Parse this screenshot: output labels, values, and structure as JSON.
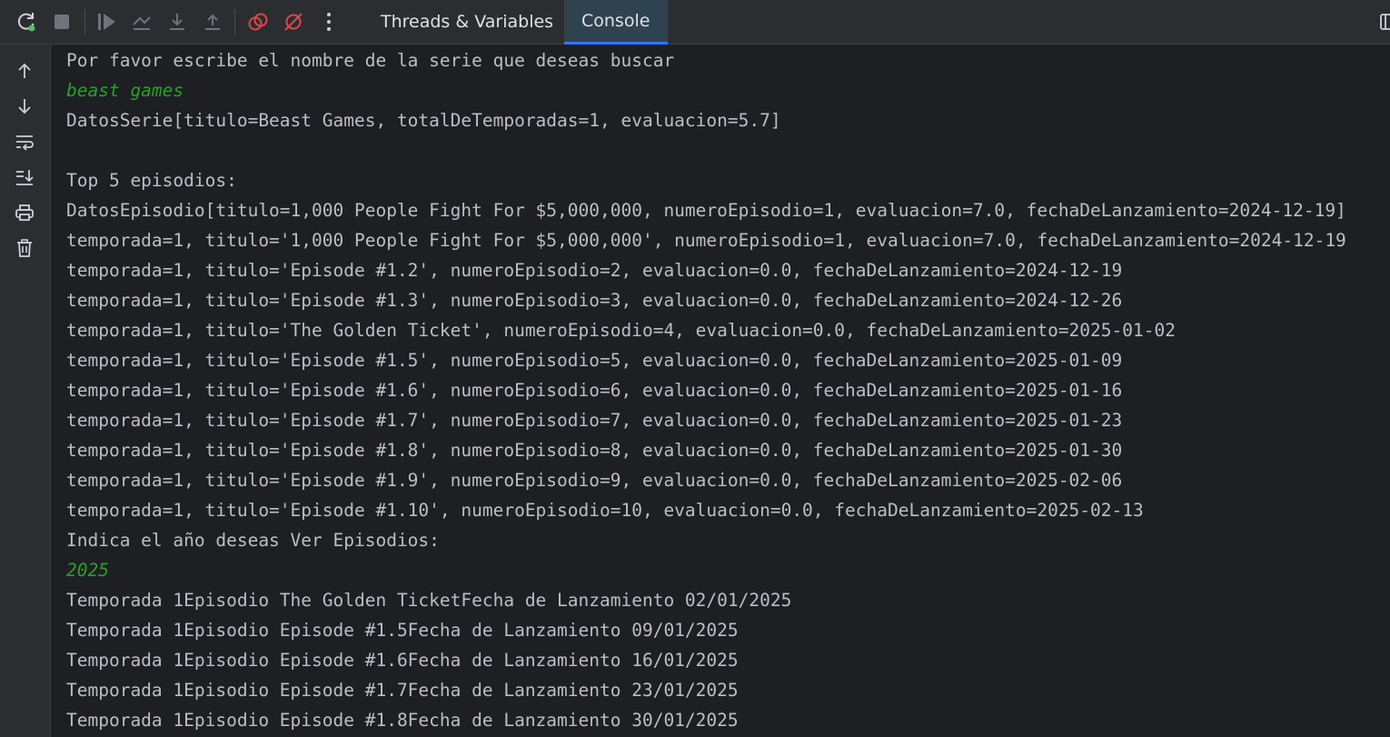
{
  "toolbar": {
    "buttons": [
      {
        "name": "rerun-debug-icon"
      },
      {
        "name": "stop-icon"
      },
      {
        "name": "resume-icon"
      },
      {
        "name": "step-over-icon"
      },
      {
        "name": "step-into-icon"
      },
      {
        "name": "step-out-icon"
      },
      {
        "name": "view-breakpoints-icon"
      },
      {
        "name": "mute-breakpoints-icon"
      },
      {
        "name": "more-options-icon"
      }
    ],
    "tabs": [
      {
        "label": "Threads & Variables",
        "active": false
      },
      {
        "label": "Console",
        "active": true
      }
    ]
  },
  "sidebar": {
    "icons": [
      "scroll-up-icon",
      "scroll-down-icon",
      "soft-wrap-icon",
      "scroll-to-end-icon",
      "print-icon",
      "clear-console-icon"
    ]
  },
  "console": {
    "lines": [
      {
        "text": "Por favor escribe el nombre de la serie que deseas buscar",
        "type": "output"
      },
      {
        "text": "beast games",
        "type": "input"
      },
      {
        "text": "DatosSerie[titulo=Beast Games, totalDeTemporadas=1, evaluacion=5.7]",
        "type": "output"
      },
      {
        "text": "",
        "type": "output"
      },
      {
        "text": "Top 5 episodios:",
        "type": "output"
      },
      {
        "text": "DatosEpisodio[titulo=1,000 People Fight For $5,000,000, numeroEpisodio=1, evaluacion=7.0, fechaDeLanzamiento=2024-12-19]",
        "type": "output"
      },
      {
        "text": "temporada=1, titulo='1,000 People Fight For $5,000,000', numeroEpisodio=1, evaluacion=7.0, fechaDeLanzamiento=2024-12-19",
        "type": "output"
      },
      {
        "text": "temporada=1, titulo='Episode #1.2', numeroEpisodio=2, evaluacion=0.0, fechaDeLanzamiento=2024-12-19",
        "type": "output"
      },
      {
        "text": "temporada=1, titulo='Episode #1.3', numeroEpisodio=3, evaluacion=0.0, fechaDeLanzamiento=2024-12-26",
        "type": "output"
      },
      {
        "text": "temporada=1, titulo='The Golden Ticket', numeroEpisodio=4, evaluacion=0.0, fechaDeLanzamiento=2025-01-02",
        "type": "output"
      },
      {
        "text": "temporada=1, titulo='Episode #1.5', numeroEpisodio=5, evaluacion=0.0, fechaDeLanzamiento=2025-01-09",
        "type": "output"
      },
      {
        "text": "temporada=1, titulo='Episode #1.6', numeroEpisodio=6, evaluacion=0.0, fechaDeLanzamiento=2025-01-16",
        "type": "output"
      },
      {
        "text": "temporada=1, titulo='Episode #1.7', numeroEpisodio=7, evaluacion=0.0, fechaDeLanzamiento=2025-01-23",
        "type": "output"
      },
      {
        "text": "temporada=1, titulo='Episode #1.8', numeroEpisodio=8, evaluacion=0.0, fechaDeLanzamiento=2025-01-30",
        "type": "output"
      },
      {
        "text": "temporada=1, titulo='Episode #1.9', numeroEpisodio=9, evaluacion=0.0, fechaDeLanzamiento=2025-02-06",
        "type": "output"
      },
      {
        "text": "temporada=1, titulo='Episode #1.10', numeroEpisodio=10, evaluacion=0.0, fechaDeLanzamiento=2025-02-13",
        "type": "output"
      },
      {
        "text": "Indica el año deseas Ver Episodios:",
        "type": "output"
      },
      {
        "text": "2025",
        "type": "input"
      },
      {
        "text": "Temporada 1Episodio The Golden TicketFecha de Lanzamiento 02/01/2025",
        "type": "output"
      },
      {
        "text": "Temporada 1Episodio Episode #1.5Fecha de Lanzamiento 09/01/2025",
        "type": "output"
      },
      {
        "text": "Temporada 1Episodio Episode #1.6Fecha de Lanzamiento 16/01/2025",
        "type": "output"
      },
      {
        "text": "Temporada 1Episodio Episode #1.7Fecha de Lanzamiento 23/01/2025",
        "type": "output"
      },
      {
        "text": "Temporada 1Episodio Episode #1.8Fecha de Lanzamiento 30/01/2025",
        "type": "output"
      }
    ]
  },
  "colors": {
    "output_text": "#bcbec4",
    "input_text": "#2a9d2a",
    "background": "#1e1f22",
    "panel": "#2b2d30",
    "accent": "#3574f0",
    "breakpoint_red": "#e0454b"
  }
}
